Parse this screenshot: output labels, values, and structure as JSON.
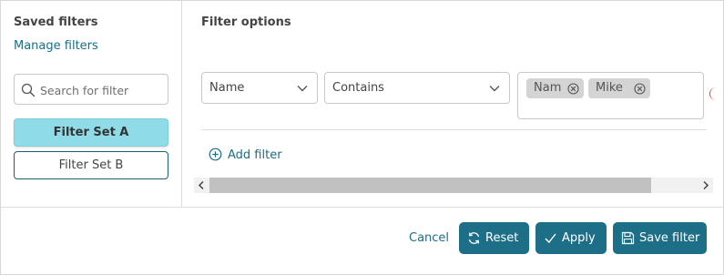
{
  "saved_filters": {
    "title": "Saved filters",
    "manage_link": "Manage filters",
    "search_placeholder": "Search for filter",
    "items": [
      {
        "label": "Filter Set A",
        "selected": true
      },
      {
        "label": "Filter Set B",
        "selected": false
      }
    ]
  },
  "filter_options": {
    "title": "Filter options",
    "rows": [
      {
        "field": "Name",
        "operator": "Contains",
        "values": [
          "Nam",
          "Mike"
        ]
      }
    ],
    "add_filter_label": "Add filter"
  },
  "footer": {
    "cancel_label": "Cancel",
    "reset_label": "Reset",
    "apply_label": "Apply",
    "save_label": "Save filter"
  },
  "icons": {
    "search": "search-icon",
    "chevron": "chevron-down-icon",
    "remove": "close-circle-icon",
    "add": "plus-circle-icon",
    "reset": "refresh-icon",
    "apply": "check-icon",
    "save": "floppy-disk-icon"
  },
  "colors": {
    "accent": "#1d6f88",
    "link": "#1a6e86",
    "selected_item": "#90dbe8",
    "chip": "#d4d4d4"
  }
}
